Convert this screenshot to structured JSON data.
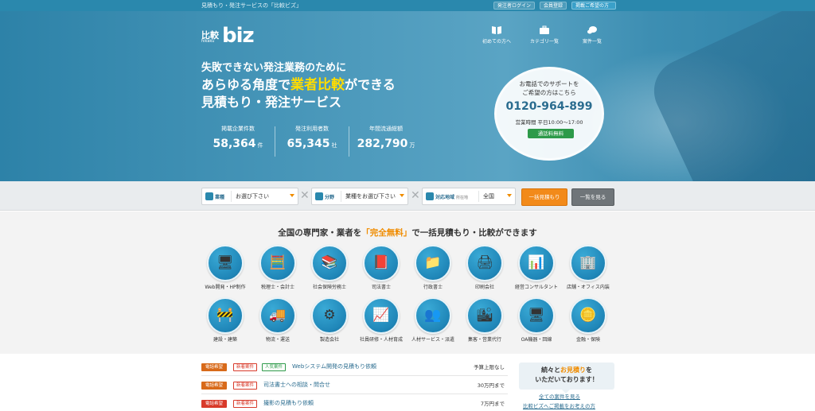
{
  "topbar": {
    "tagline": "見積もり・発注サービスの「比較ビズ」",
    "links": [
      {
        "label": "発注者ログイン"
      },
      {
        "label": "会員登録"
      },
      {
        "label": "掲載ご希望の方"
      }
    ]
  },
  "logo": {
    "kanji": "比較",
    "kana": "hikaku",
    "word": "biz"
  },
  "nav": [
    {
      "label": "初めての方へ",
      "icon": "book-icon"
    },
    {
      "label": "カテゴリ一覧",
      "icon": "briefcase-icon"
    },
    {
      "label": "案件一覧",
      "icon": "speech-bubble-icon"
    }
  ],
  "hero": {
    "line1": "失敗できない発注業務のために",
    "line2_pre": "あらゆる角度で",
    "line2_highlight": "業者比較",
    "line2_post": "ができる",
    "line3": "見積もり・発注サービス"
  },
  "stats": [
    {
      "label": "掲載企業件数",
      "value": "58,364",
      "unit": "件"
    },
    {
      "label": "発注利用者数",
      "value": "65,345",
      "unit": "社"
    },
    {
      "label": "年間流通総額",
      "value": "282,790",
      "unit": "万"
    }
  ],
  "phone": {
    "line1": "お電話でのサポートを",
    "line2": "ご希望の方はこちら",
    "number": "0120-964-899",
    "hours": "営業時間 平日10:00～17:00",
    "free": "通話料無料"
  },
  "search": {
    "industry_label": "業種",
    "industry_value": "お選び下さい",
    "field_label": "分野",
    "field_value": "業種をお選び下さい",
    "region_label": "対応地域",
    "region_sub": "所在地",
    "region_value": "全国",
    "submit_label": "一括見積もり",
    "list_label": "一覧を見る"
  },
  "categories_title": {
    "pre": "全国の専門家・業者を",
    "highlight": "「完全無料」",
    "post": "で一括見積もり・比較ができます"
  },
  "categories": [
    {
      "label": "Web開発・HP制作",
      "glyph": "🖥"
    },
    {
      "label": "税理士・会計士",
      "glyph": "🧮"
    },
    {
      "label": "社会保険労務士",
      "glyph": "📚"
    },
    {
      "label": "司法書士",
      "glyph": "📕"
    },
    {
      "label": "行政書士",
      "glyph": "📁"
    },
    {
      "label": "印刷会社",
      "glyph": "🖨"
    },
    {
      "label": "経営コンサルタント",
      "glyph": "📊"
    },
    {
      "label": "店舗・オフィス内装",
      "glyph": "🏢"
    },
    {
      "label": "建設・建築",
      "glyph": "🚧"
    },
    {
      "label": "物流・運送",
      "glyph": "🚚"
    },
    {
      "label": "製造会社",
      "glyph": "⚙"
    },
    {
      "label": "社員研修・人材育成",
      "glyph": "📈"
    },
    {
      "label": "人材サービス・派遣",
      "glyph": "👥"
    },
    {
      "label": "集客・営業代行",
      "glyph": "🏙"
    },
    {
      "label": "OA機器・回線",
      "glyph": "🖥"
    },
    {
      "label": "金融・保険",
      "glyph": "🪙"
    }
  ],
  "news": [
    {
      "tag1": "電話希望",
      "tag2": "新着案件",
      "tag3": "人気案件",
      "title": "Webシステム開発の見積もり依頼",
      "price": "予算上限なし"
    },
    {
      "tag1": "電話希望",
      "tag2": "新着案件",
      "tag3": "",
      "title": "司法書士への相談・問合せ",
      "price": "30万円まで"
    },
    {
      "tag1": "電話希望",
      "tag2": "新着案件",
      "tag3": "",
      "title": "撮影の見積もり依頼",
      "price": "7万円まで"
    }
  ],
  "aside": {
    "pre": "続々と",
    "highlight": "お見積り",
    "post": "を",
    "line2": "いただいております！",
    "link1": "全ての案件を見る",
    "link2": "比較ビズへご掲載をお考えの方"
  },
  "colors": {
    "brand": "#2a88ad",
    "accent": "#f08c00",
    "highlight": "#ffdc00",
    "tel": "#d83a2a",
    "green": "#2d9a49"
  }
}
